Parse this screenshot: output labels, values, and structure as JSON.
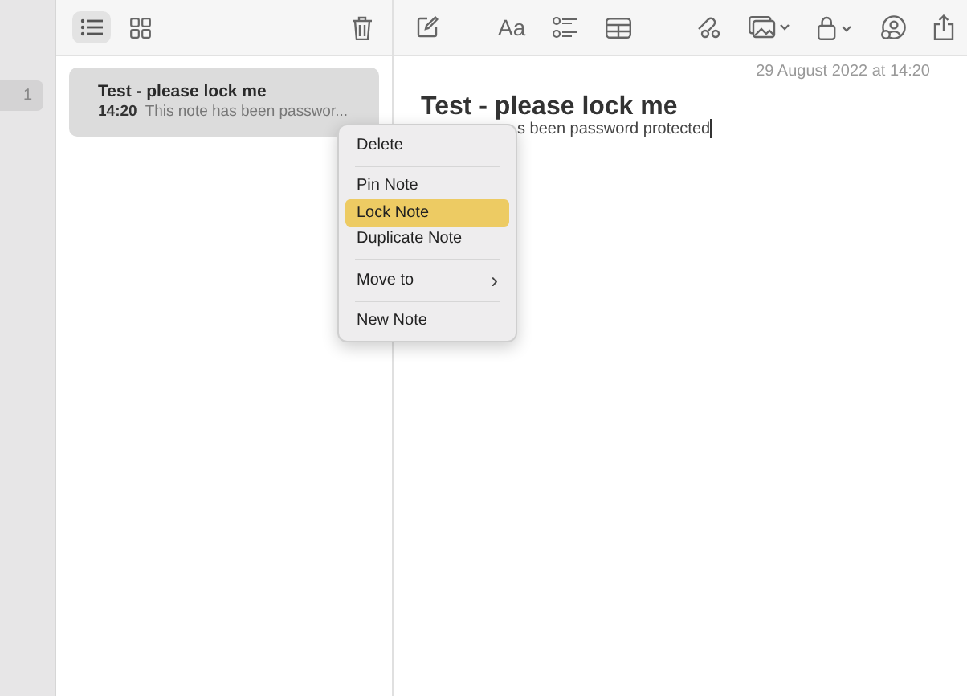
{
  "sidebar": {
    "items": [
      {
        "label": "1",
        "selected": true
      }
    ]
  },
  "list_toolbar": {
    "view_buttons": [
      {
        "kind": "list",
        "selected": true
      },
      {
        "kind": "grid",
        "selected": false
      }
    ]
  },
  "notes": [
    {
      "title": "Test - please lock me",
      "time": "14:20",
      "preview": "This note has been passwor...",
      "selected": true
    }
  ],
  "editor_toolbar": {
    "format_label": "Aa"
  },
  "editor": {
    "date": "29 August 2022 at 14:20",
    "title": "Test - please lock me",
    "body_visible": "s been password protected"
  },
  "context_menu": {
    "groups": [
      [
        {
          "label": "Delete",
          "selected": false
        }
      ],
      [
        {
          "label": "Pin Note",
          "selected": false
        },
        {
          "label": "Lock Note",
          "selected": true
        },
        {
          "label": "Duplicate Note",
          "selected": false
        }
      ],
      [
        {
          "label": "Move to",
          "selected": false,
          "submenu": true,
          "arrow": "›"
        }
      ],
      [
        {
          "label": "New Note",
          "selected": false
        }
      ]
    ]
  }
}
